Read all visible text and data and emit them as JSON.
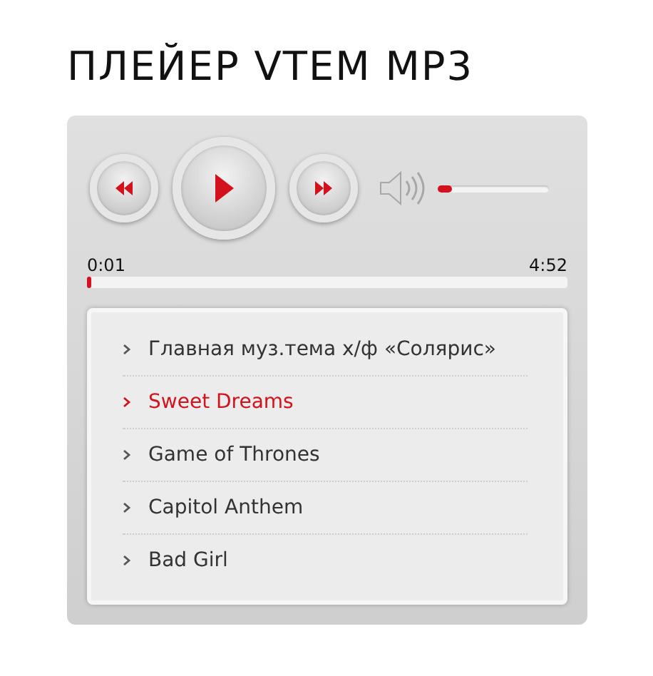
{
  "title": "ПЛЕЙЕР VTEM MP3",
  "player": {
    "volume": {
      "level": 0.13
    },
    "elapsed": "0:01",
    "duration": "4:52",
    "progress": {
      "level": 0.01
    }
  },
  "playlist": [
    {
      "title": "Главная муз.тема х/ф «Солярис»",
      "selected": false
    },
    {
      "title": "Sweet Dreams",
      "selected": true
    },
    {
      "title": "Game of Thrones",
      "selected": false
    },
    {
      "title": "Capitol Anthem",
      "selected": false
    },
    {
      "title": "Bad Girl",
      "selected": false
    }
  ]
}
